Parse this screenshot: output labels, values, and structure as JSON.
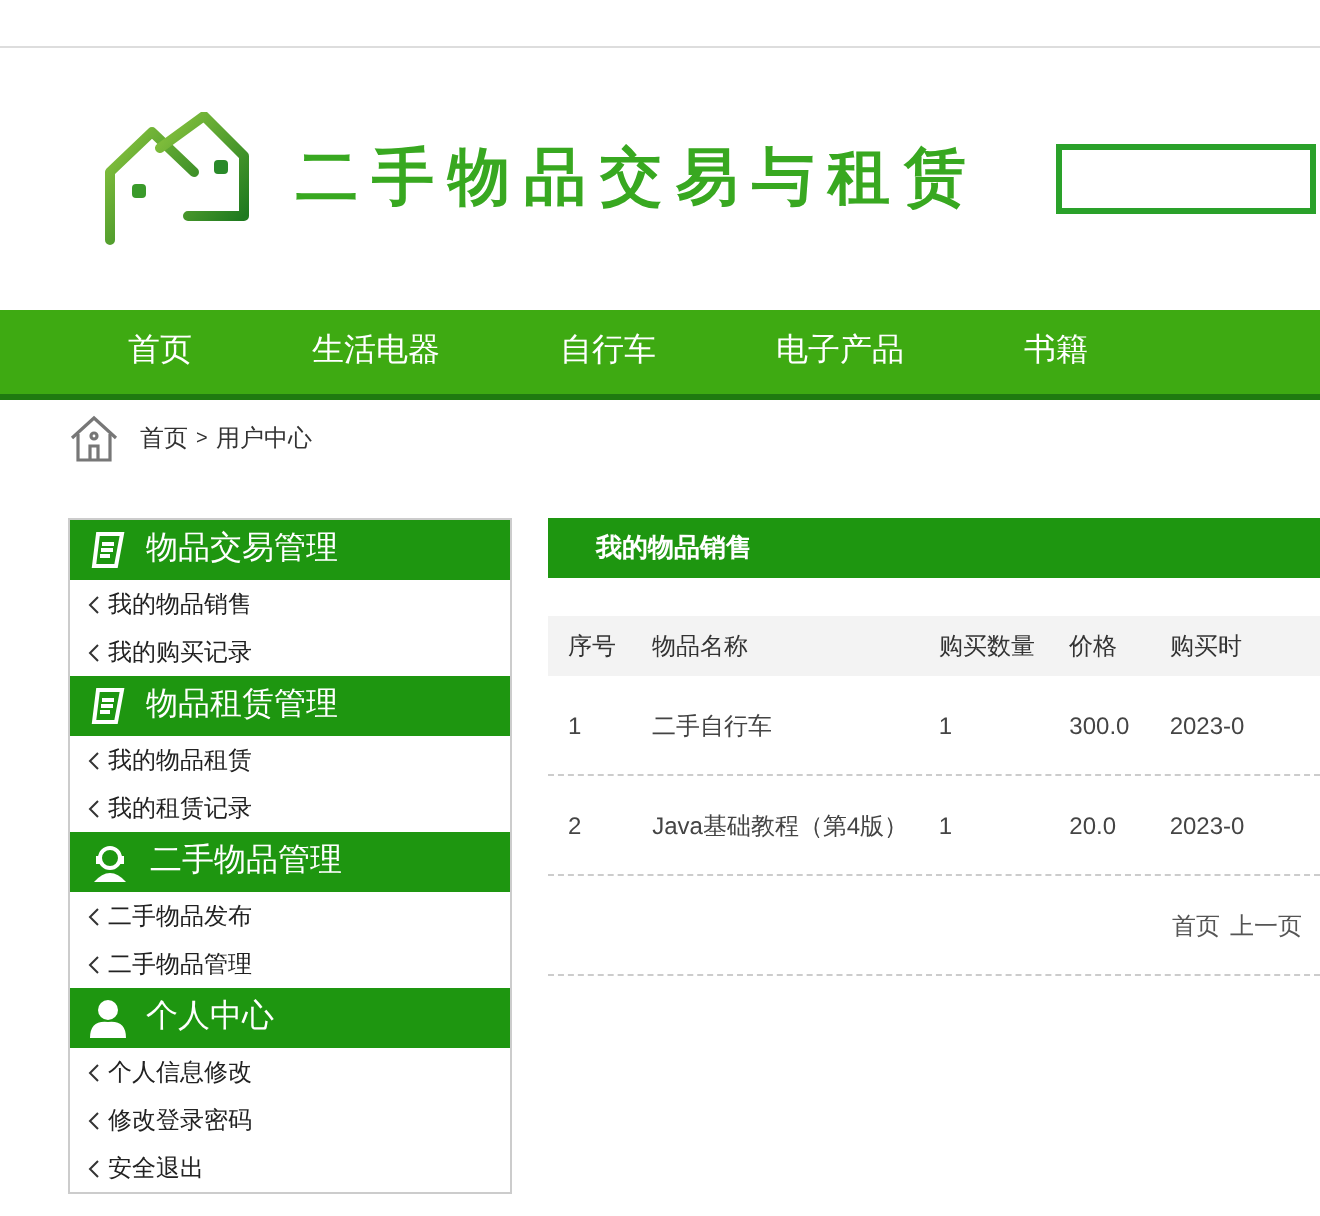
{
  "site": {
    "title": "二手物品交易与租赁"
  },
  "nav": [
    {
      "label": "首页"
    },
    {
      "label": "生活电器"
    },
    {
      "label": "自行车"
    },
    {
      "label": "电子产品"
    },
    {
      "label": "书籍"
    }
  ],
  "breadcrumb": [
    "首页",
    ">",
    "用户中心"
  ],
  "sidebar": [
    {
      "title": "物品交易管理",
      "kind": "doc",
      "items": [
        "我的物品销售",
        "我的购买记录"
      ]
    },
    {
      "title": "物品租赁管理",
      "kind": "doc",
      "items": [
        "我的物品租赁",
        "我的租赁记录"
      ]
    },
    {
      "title": "二手物品管理",
      "kind": "agent",
      "items": [
        "二手物品发布",
        "二手物品管理"
      ]
    },
    {
      "title": "个人中心",
      "kind": "person",
      "items": [
        "个人信息修改",
        "修改登录密码",
        "安全退出"
      ]
    }
  ],
  "panel": {
    "title": "我的物品销售",
    "table": {
      "columns": [
        "序号",
        "物品名称",
        "购买数量",
        "价格",
        "购买时"
      ],
      "rows": [
        [
          "1",
          "二手自行车",
          "1",
          "300.0",
          "2023-0"
        ],
        [
          "2",
          "Java基础教程（第4版）",
          "1",
          "20.0",
          "2023-0"
        ]
      ]
    },
    "pagination": [
      "首页",
      "上一页"
    ]
  }
}
